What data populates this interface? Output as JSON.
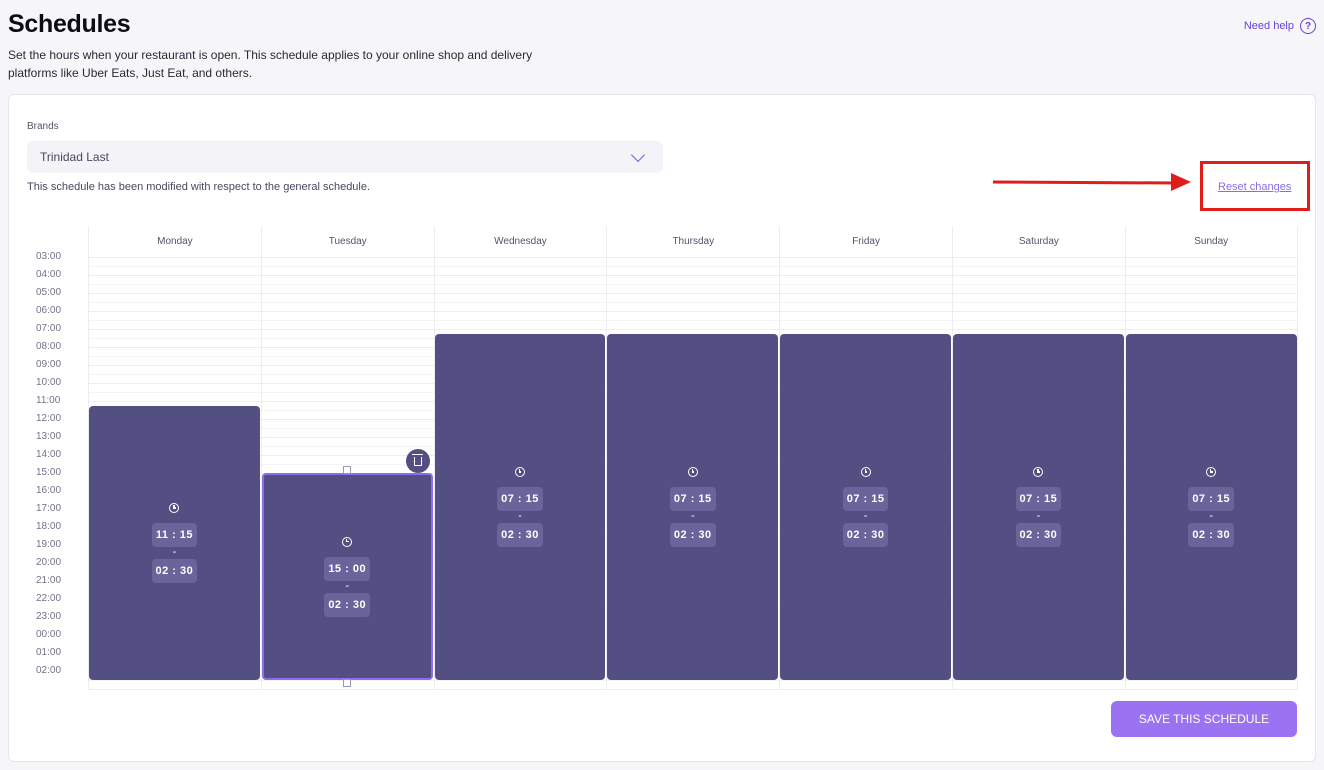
{
  "header": {
    "title": "Schedules",
    "description": "Set the hours when your restaurant is open. This schedule applies to your online shop and delivery platforms like Uber Eats, Just Eat, and others.",
    "help_label": "Need help",
    "help_icon": "question-circle-icon"
  },
  "brands": {
    "label": "Brands",
    "selected": "Trinidad Last",
    "icon": "chevron-down-icon"
  },
  "notice": "This schedule has been modified with respect to the general schedule.",
  "reset_label": "Reset changes",
  "annotation": {
    "color": "#e01d1d"
  },
  "calendar": {
    "days": [
      "Monday",
      "Tuesday",
      "Wednesday",
      "Thursday",
      "Friday",
      "Saturday",
      "Sunday"
    ],
    "hours": [
      "03:00",
      "04:00",
      "05:00",
      "06:00",
      "07:00",
      "08:00",
      "09:00",
      "10:00",
      "11:00",
      "12:00",
      "13:00",
      "14:00",
      "15:00",
      "16:00",
      "17:00",
      "18:00",
      "19:00",
      "20:00",
      "21:00",
      "22:00",
      "23:00",
      "00:00",
      "01:00",
      "02:00"
    ],
    "first_hour": 3,
    "slots": [
      {
        "day": "Monday",
        "start": "11 : 15",
        "end": "02 : 30",
        "selected": false
      },
      {
        "day": "Tuesday",
        "start": "15 : 00",
        "end": "02 : 30",
        "selected": true
      },
      {
        "day": "Wednesday",
        "start": "07 : 15",
        "end": "02 : 30",
        "selected": false
      },
      {
        "day": "Thursday",
        "start": "07 : 15",
        "end": "02 : 30",
        "selected": false
      },
      {
        "day": "Friday",
        "start": "07 : 15",
        "end": "02 : 30",
        "selected": false
      },
      {
        "day": "Saturday",
        "start": "07 : 15",
        "end": "02 : 30",
        "selected": false
      },
      {
        "day": "Sunday",
        "start": "07 : 15",
        "end": "02 : 30",
        "selected": false
      }
    ],
    "dash": "-",
    "slot_color": "#544f82",
    "selected_border": "#8e6cf0"
  },
  "save_label": "SAVE THIS SCHEDULE",
  "accent": "#9b72f2"
}
